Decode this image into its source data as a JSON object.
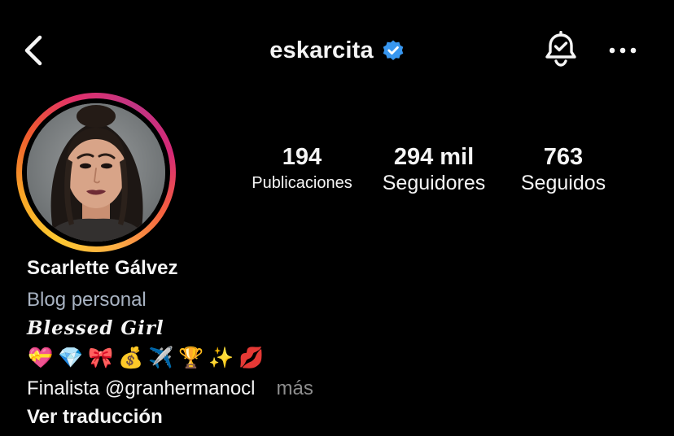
{
  "header": {
    "username": "eskarcita",
    "verified_color": "#3897f0"
  },
  "avatar": {
    "ring_colors": [
      "#fdc830",
      "#f56040",
      "#e1306c",
      "#c13584"
    ]
  },
  "stats": {
    "posts_count": "194",
    "posts_label": "Publicaciones",
    "followers_count": "294 mil",
    "followers_label": "Seguidores",
    "following_count": "763",
    "following_label": "Seguidos"
  },
  "bio": {
    "display_name": "Scarlette Gálvez",
    "category": "Blog personal",
    "tagline": "Blessed Girl",
    "emojis": [
      "💝",
      "💎",
      "🎀",
      "💰",
      "✈️",
      "🏆",
      "✨",
      "💋"
    ],
    "line_prefix": "Finalista ",
    "mention": "@granhermanocl",
    "more": "más",
    "translate": "Ver traducción"
  },
  "icons": {
    "back": "chevron-left-icon",
    "verified": "verified-badge-icon",
    "notifications": "bell-check-icon",
    "more": "more-horizontal-icon"
  }
}
